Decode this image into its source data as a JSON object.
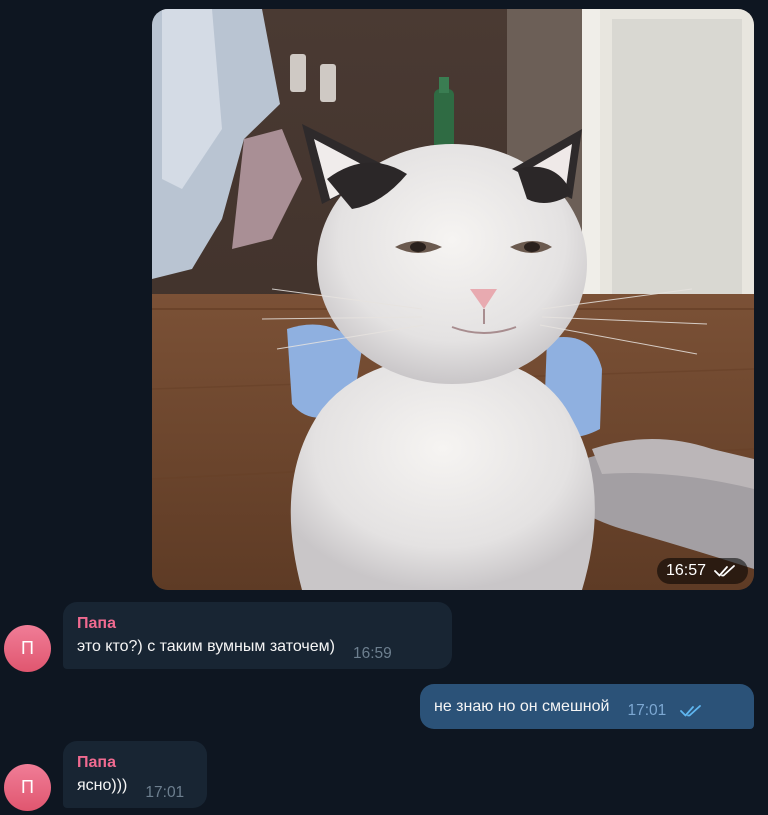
{
  "messages": [
    {
      "type": "photo",
      "direction": "outgoing",
      "time": "16:57",
      "status_icon": "double-check-icon"
    },
    {
      "type": "text",
      "direction": "incoming",
      "sender": "Папа",
      "avatar_letter": "П",
      "text": "это кто?) с таким вумным заточем)",
      "time": "16:59"
    },
    {
      "type": "text",
      "direction": "outgoing",
      "text": "не знаю но он смешной",
      "time": "17:01",
      "status_icon": "double-check-icon"
    },
    {
      "type": "text",
      "direction": "incoming",
      "sender": "Папа",
      "avatar_letter": "П",
      "text": "ясно)))",
      "time": "17:01"
    }
  ],
  "colors": {
    "background": "#0e1621",
    "incoming_bubble": "#182533",
    "outgoing_bubble": "#2b5278",
    "sender_name": "#f06a90",
    "avatar": "#e8637d",
    "read_check": "#5fb6f0"
  }
}
